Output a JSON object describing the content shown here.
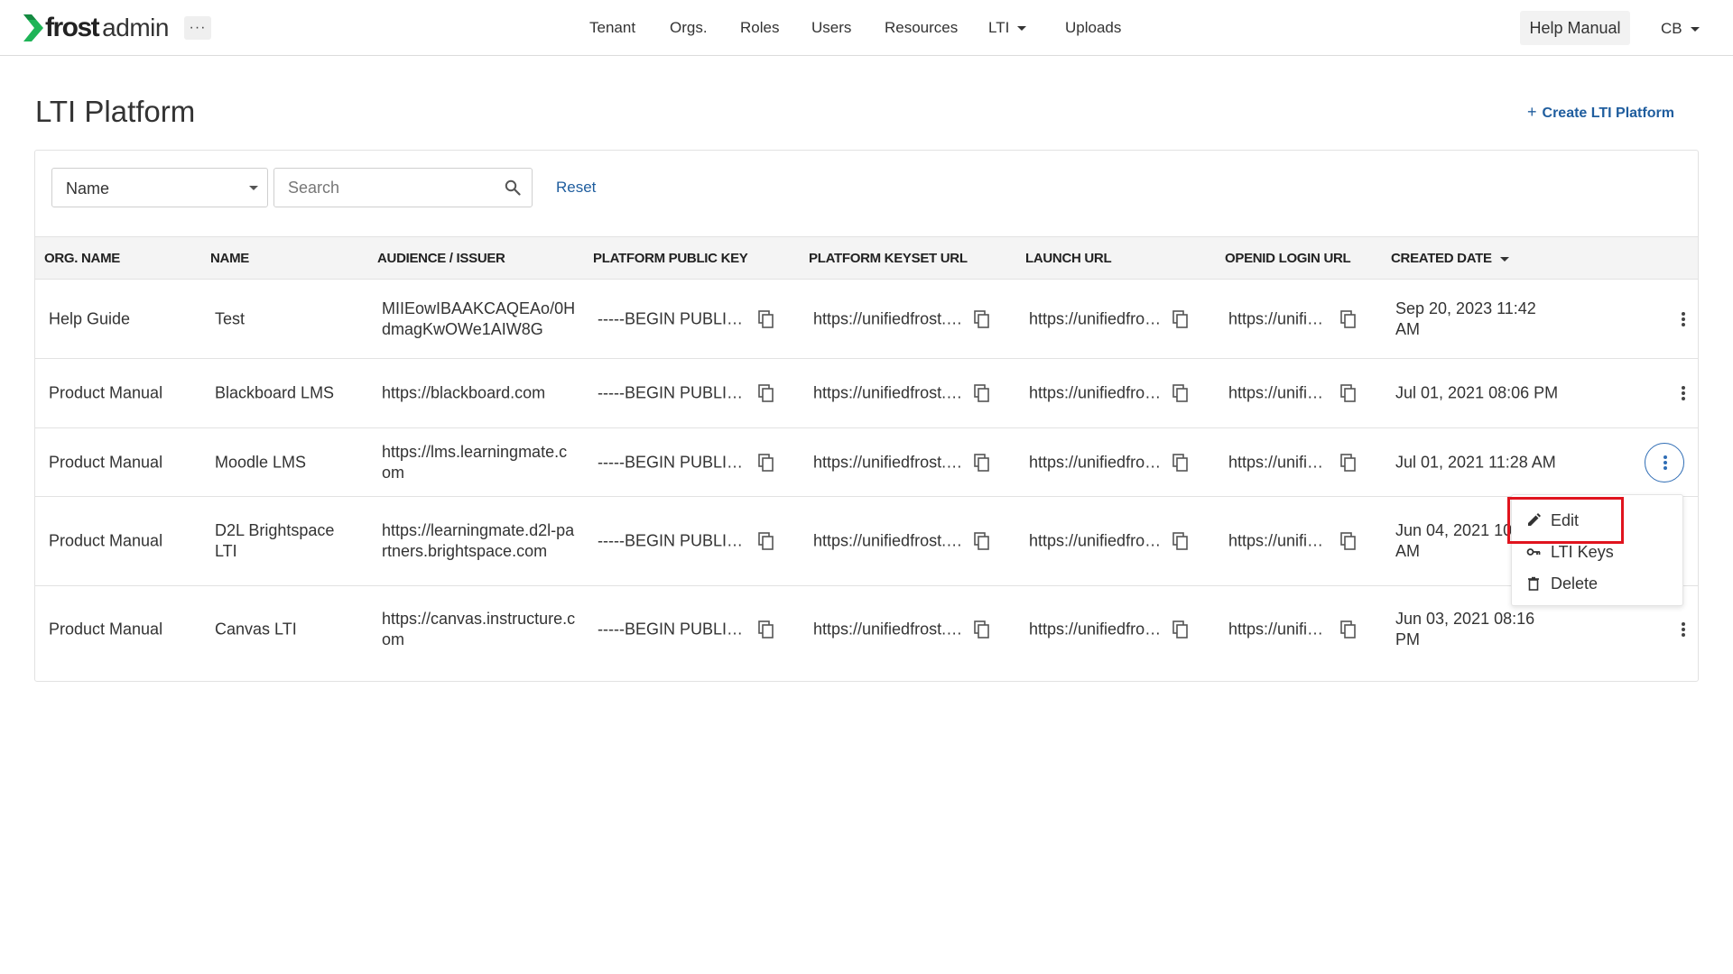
{
  "header": {
    "logo_frost": "frost",
    "logo_admin": "admin",
    "more_label": "···",
    "nav": [
      {
        "label": "Tenant"
      },
      {
        "label": "Orgs."
      },
      {
        "label": "Roles"
      },
      {
        "label": "Users"
      },
      {
        "label": "Resources"
      },
      {
        "label": "LTI"
      },
      {
        "label": "Uploads"
      }
    ],
    "help_label": "Help Manual",
    "user_initials": "CB"
  },
  "page": {
    "title": "LTI Platform",
    "create_label": "Create LTI Platform"
  },
  "filter": {
    "field_value": "Name",
    "search_placeholder": "Search",
    "reset_label": "Reset"
  },
  "table": {
    "columns": [
      "ORG. NAME",
      "NAME",
      "AUDIENCE / ISSUER",
      "PLATFORM PUBLIC KEY",
      "PLATFORM KEYSET URL",
      "LAUNCH URL",
      "OPENID LOGIN URL",
      "CREATED DATE"
    ],
    "sort_column": "CREATED DATE",
    "rows": [
      {
        "org": "Help Guide",
        "name": "Test",
        "audience": "MIIEowIBAAKCAQEAo/0HdmagKwOWe1AIW8G",
        "public_key": "-----BEGIN PUBLIC KEY-----",
        "keyset_url": "https://unifiedfrost.com/keys",
        "launch_url": "https://unifiedfrost.com/launch",
        "openid_url": "https://unifiedfrost.com/login",
        "created": "Sep 20, 2023 11:42 AM"
      },
      {
        "org": "Product Manual",
        "name": "Blackboard LMS",
        "audience": "https://blackboard.com",
        "public_key": "-----BEGIN PUBLIC KEY-----",
        "keyset_url": "https://unifiedfrost.com/keys",
        "launch_url": "https://unifiedfrost.com/launch",
        "openid_url": "https://unifiedfrost.com/login",
        "created": "Jul 01, 2021 08:06 PM"
      },
      {
        "org": "Product Manual",
        "name": "Moodle LMS",
        "audience": "https://lms.learningmate.com",
        "public_key": "-----BEGIN PUBLIC KEY-----",
        "keyset_url": "https://unifiedfrost.com/keys",
        "launch_url": "https://unifiedfrost.com/launch",
        "openid_url": "https://unifiedfrost.com/login",
        "created": "Jul 01, 2021 11:28 AM"
      },
      {
        "org": "Product Manual",
        "name": "D2L Brightspace LTI",
        "audience": "https://learningmate.d2l-partners.brightspace.com",
        "public_key": "-----BEGIN PUBLIC KEY-----",
        "keyset_url": "https://unifiedfrost.com/keys",
        "launch_url": "https://unifiedfrost.com/launch",
        "openid_url": "https://unifiedfrost.com/login",
        "created": "Jun 04, 2021 10:"
      },
      {
        "org": "Product Manual",
        "name": "Canvas LTI",
        "audience": "https://canvas.instructure.com",
        "public_key": "-----BEGIN PUBLIC KEY-----",
        "keyset_url": "https://unifiedfrost.com/keys",
        "launch_url": "https://unifiedfrost.com/launch",
        "openid_url": "https://unifiedfrost.com/login",
        "created": "Jun 03, 2021 08:16 PM"
      }
    ]
  },
  "row_d2l_created_suffix": "AM",
  "menu": {
    "items": [
      {
        "label": "Edit",
        "icon": "pencil-icon"
      },
      {
        "label": "LTI Keys",
        "icon": "key-icon"
      },
      {
        "label": "Delete",
        "icon": "trash-icon"
      }
    ]
  },
  "colors": {
    "link": "#1f5d9e",
    "accent_green": "#1fb457",
    "active_outline": "#2f6db5",
    "highlight": "#e0141e"
  }
}
